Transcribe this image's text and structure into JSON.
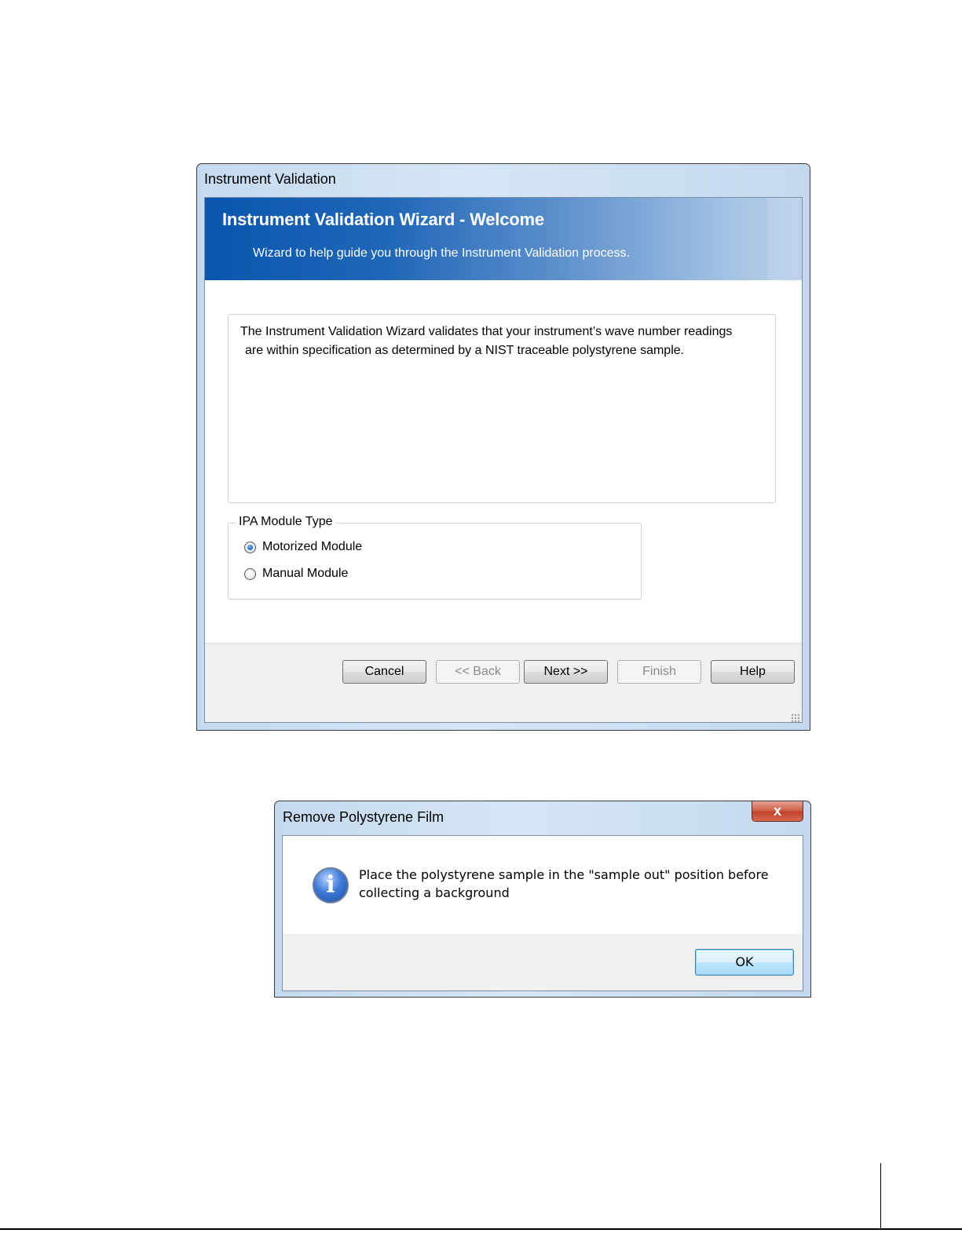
{
  "wizard_window": {
    "title": "Instrument Validation",
    "header": {
      "title": "Instrument Validation Wizard - Welcome",
      "subtitle": "Wizard to help guide you through the Instrument Validation process."
    },
    "description": {
      "line1": "The Instrument Validation Wizard validates that your instrument’s wave number readings",
      "line2": "are within specification as determined by a NIST traceable polystyrene sample."
    },
    "module_type": {
      "label": "IPA Module Type",
      "options": [
        {
          "label": "Motorized Module",
          "selected": true
        },
        {
          "label": "Manual Module",
          "selected": false
        }
      ]
    },
    "buttons": {
      "cancel": "Cancel",
      "back": "<< Back",
      "next": "Next >>",
      "finish": "Finish",
      "help": "Help"
    }
  },
  "message_window": {
    "title": "Remove Polystyrene Film",
    "close_glyph": "x",
    "icon": "info-icon",
    "message": "Place the polystyrene sample in the \"sample out\" position before collecting a background",
    "ok_label": "OK"
  }
}
